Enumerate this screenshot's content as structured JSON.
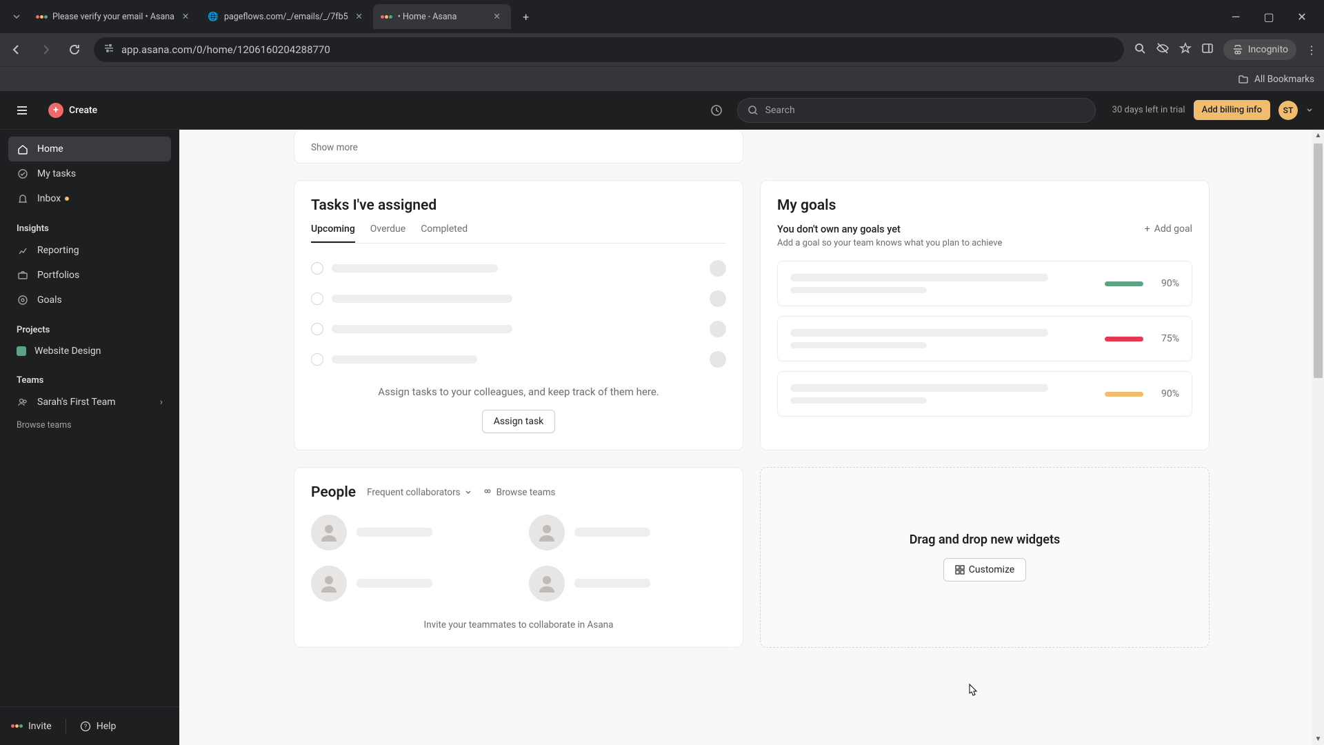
{
  "browser": {
    "tabs": [
      {
        "title": "Please verify your email • Asana",
        "active": false,
        "favicon": "asana"
      },
      {
        "title": "pageflows.com/_/emails/_/7fb5",
        "active": false,
        "favicon": "globe"
      },
      {
        "title": "• Home - Asana",
        "active": true,
        "favicon": "asana"
      }
    ],
    "url": "app.asana.com/0/home/1206160204288770",
    "incognito": "Incognito",
    "all_bookmarks": "All Bookmarks"
  },
  "header": {
    "create": "Create",
    "search_placeholder": "Search",
    "trial": "30 days left in trial",
    "billing": "Add billing info",
    "avatar": "ST"
  },
  "sidebar": {
    "home": "Home",
    "my_tasks": "My tasks",
    "inbox": "Inbox",
    "insights": "Insights",
    "reporting": "Reporting",
    "portfolios": "Portfolios",
    "goals": "Goals",
    "projects": "Projects",
    "project_name": "Website Design",
    "teams": "Teams",
    "team_name": "Sarah's First Team",
    "browse_teams": "Browse teams",
    "invite": "Invite",
    "help": "Help"
  },
  "tasks": {
    "show_more": "Show more",
    "title": "Tasks I've assigned",
    "tab_upcoming": "Upcoming",
    "tab_overdue": "Overdue",
    "tab_completed": "Completed",
    "placeholder": "Assign tasks to your colleagues, and keep track of them here.",
    "assign_btn": "Assign task"
  },
  "goals": {
    "title": "My goals",
    "empty_title": "You don't own any goals yet",
    "empty_sub": "Add a goal so your team knows what you plan to achieve",
    "add": "Add goal",
    "items": [
      {
        "pct": "90%",
        "color": "pg-green"
      },
      {
        "pct": "75%",
        "color": "pg-red"
      },
      {
        "pct": "90%",
        "color": "pg-yellow"
      }
    ]
  },
  "people": {
    "title": "People",
    "dropdown": "Frequent collaborators",
    "browse": "Browse teams",
    "invite": "Invite your teammates to collaborate in Asana"
  },
  "dropzone": {
    "title": "Drag and drop new widgets",
    "customize": "Customize"
  }
}
